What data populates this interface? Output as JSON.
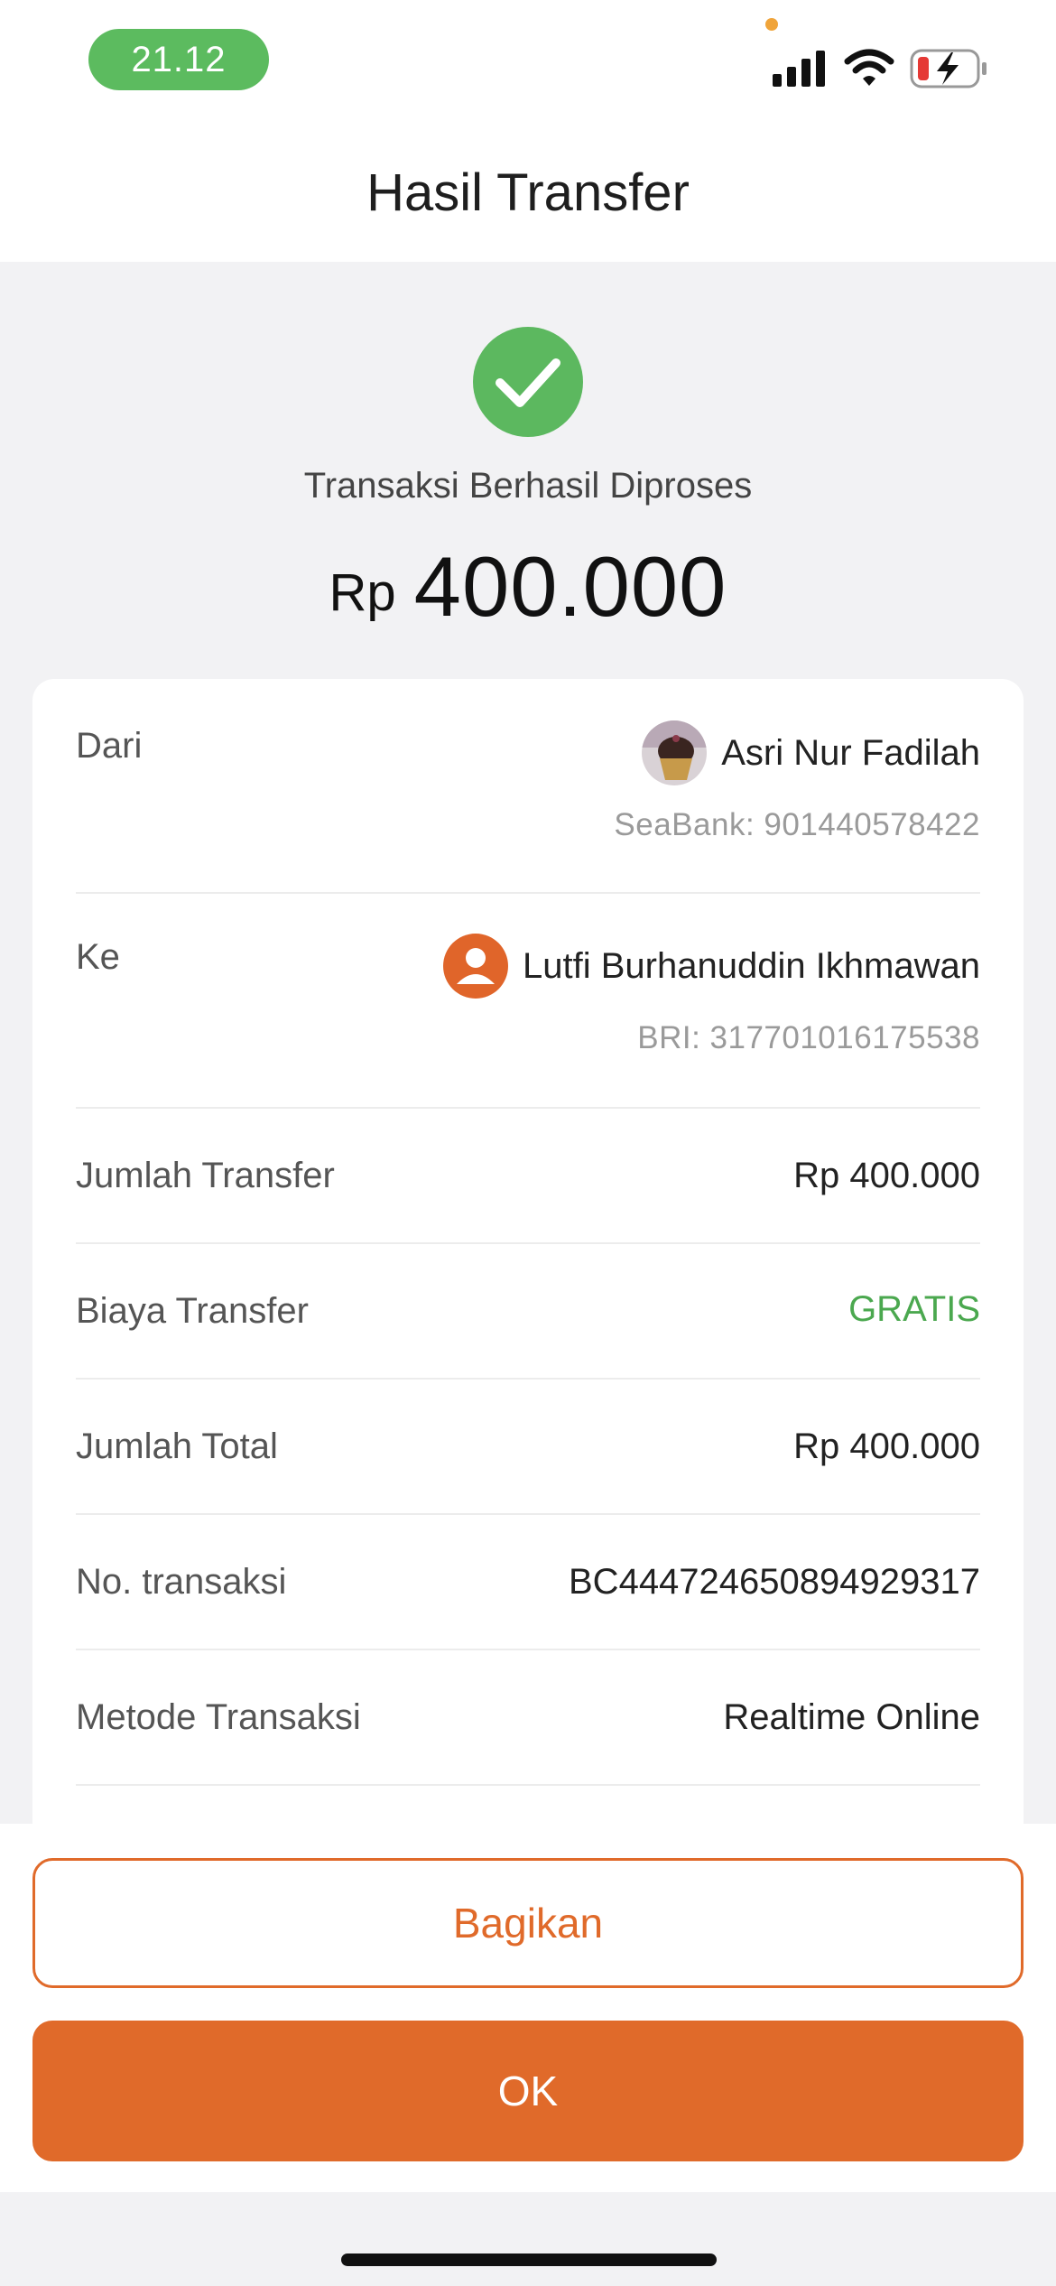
{
  "status_bar": {
    "time": "21.12",
    "icons": [
      "signal-icon",
      "wifi-icon",
      "battery-charging-icon"
    ],
    "time_pill_color": "#5cbb5f"
  },
  "header": {
    "title": "Hasil Transfer"
  },
  "result": {
    "icon": "check-circle-icon",
    "status_text": "Transaksi Berhasil Diproses",
    "currency": "Rp",
    "amount": "400.000",
    "success_color": "#5cb85f"
  },
  "details": {
    "from": {
      "label": "Dari",
      "name": "Asri Nur Fadilah",
      "account": "SeaBank: 901440578422",
      "avatar": "profile-photo"
    },
    "to": {
      "label": "Ke",
      "name": "Lutfi Burhanuddin Ikhmawan",
      "account": "BRI: 317701016175538",
      "avatar": "default-user-icon"
    },
    "rows": [
      {
        "label": "Jumlah Transfer",
        "value": "Rp 400.000"
      },
      {
        "label": "Biaya Transfer",
        "value": "GRATIS"
      },
      {
        "label": "Jumlah Total",
        "value": "Rp 400.000"
      },
      {
        "label": "No. transaksi",
        "value": "BC444724650894929317"
      },
      {
        "label": "Metode Transaksi",
        "value": "Realtime Online"
      }
    ]
  },
  "actions": {
    "share_label": "Bagikan",
    "ok_label": "OK",
    "accent_color": "#e06a2a"
  }
}
